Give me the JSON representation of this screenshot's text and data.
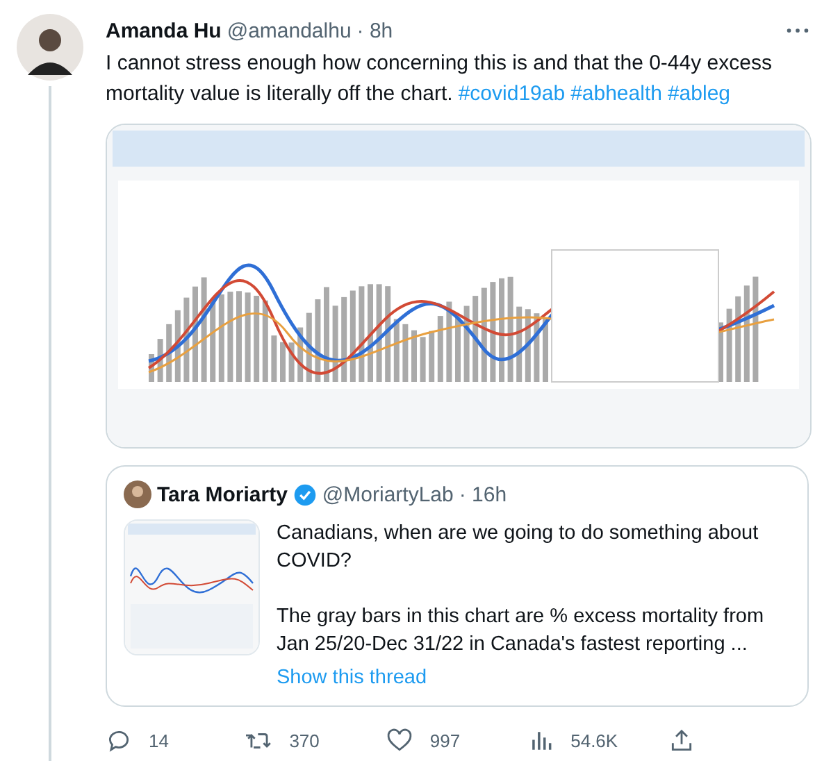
{
  "tweet": {
    "name": "Amanda Hu",
    "handle": "@amandalhu",
    "time": "· 8h",
    "text": "I cannot stress enough how concerning this is and that the 0-44y excess mortality value is literally off the chart.",
    "hashtags": [
      "#covid19ab",
      "#abhealth",
      "#ableg"
    ]
  },
  "quoted": {
    "name": "Tara Moriarty",
    "verified": true,
    "handle": "@MoriartyLab",
    "time": "· 16h",
    "paragraphs": [
      "Canadians, when are we going to do something about COVID?",
      "The gray bars in this chart are % excess mortality from Jan 25/20-Dec 31/22 in Canada's fastest reporting ..."
    ],
    "link": "Show this thread"
  },
  "actions": [
    {
      "kind": "reply",
      "count": "14"
    },
    {
      "kind": "retweet",
      "count": "370"
    },
    {
      "kind": "like",
      "count": "997"
    },
    {
      "kind": "views",
      "count": "54.6K"
    },
    {
      "kind": "share"
    }
  ]
}
